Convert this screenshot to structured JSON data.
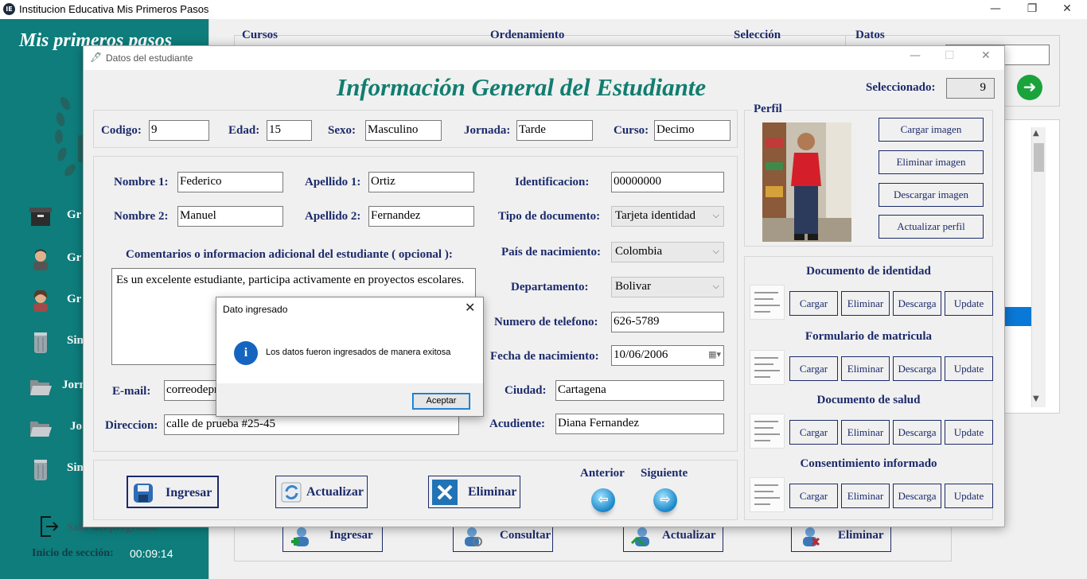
{
  "window": {
    "title": "Institucion Educativa Mis Primeros Pasos",
    "app_icon": "IE",
    "minimize": "—",
    "restore": "❐",
    "close": "✕"
  },
  "sidebar": {
    "brand": "Mis primeros pasos",
    "items": [
      {
        "label": "Gr",
        "icon": "archive-box-icon"
      },
      {
        "label": "Gr",
        "icon": "teacher-icon"
      },
      {
        "label": "Gr",
        "icon": "teacher-woman-icon"
      },
      {
        "label": "Sin",
        "icon": "trash-can-icon"
      },
      {
        "label": "Jorn",
        "icon": "open-folder-icon"
      },
      {
        "label": "Jo",
        "icon": "open-folder-icon"
      },
      {
        "label": "Sin",
        "icon": "trash-can-icon"
      }
    ],
    "logout": "Salir del programa",
    "session_label": "Inicio de sección:",
    "session_time": "00:09:14",
    "color": "#0e7d7c"
  },
  "background": {
    "groups": [
      "Cursos",
      "Ordenamiento",
      "Selección",
      "Datos"
    ],
    "actions": [
      "Ingresar",
      "Consultar",
      "Actualizar",
      "Eliminar"
    ]
  },
  "dialog": {
    "title": "Datos del estudiante",
    "heading": "Información General del Estudiante",
    "selected_label": "Seleccionado:",
    "selected_value": "9",
    "top_row": {
      "codigo_label": "Codigo:",
      "codigo": "9",
      "edad_label": "Edad:",
      "edad": "15",
      "sexo_label": "Sexo:",
      "sexo": "Masculino",
      "jornada_label": "Jornada:",
      "jornada": "Tarde",
      "curso_label": "Curso:",
      "curso": "Decimo"
    },
    "form": {
      "nombre1_label": "Nombre 1:",
      "nombre1": "Federico",
      "apellido1_label": "Apellido 1:",
      "apellido1": "Ortiz",
      "nombre2_label": "Nombre 2:",
      "nombre2": "Manuel",
      "apellido2_label": "Apellido 2:",
      "apellido2": "Fernandez",
      "comments_label": "Comentarios o informacion adicional del estudiante ( opcional ):",
      "comments": "Es un excelente estudiante, participa activamente en proyectos escolares.",
      "email_label": "E-mail:",
      "email": "correodeprueba@gmail.com",
      "direccion_label": "Direccion:",
      "direccion": "calle de prueba #25-45",
      "identificacion_label": "Identificacion:",
      "identificacion": "00000000",
      "tipo_doc_label": "Tipo de documento:",
      "tipo_doc": "Tarjeta identidad",
      "pais_label": "País de nacimiento:",
      "pais": "Colombia",
      "departamento_label": "Departamento:",
      "departamento": "Bolivar",
      "telefono_label": "Numero de telefono:",
      "telefono": "626-5789",
      "fecha_label": "Fecha de nacimiento:",
      "fecha": "10/06/2006",
      "ciudad_label": "Ciudad:",
      "ciudad": "Cartagena",
      "acudiente_label": "Acudiente:",
      "acudiente": "Diana Fernandez"
    },
    "profile": {
      "label": "Perfil",
      "buttons": [
        "Cargar imagen",
        "Eliminar imagen",
        "Descargar imagen",
        "Actualizar perfil"
      ]
    },
    "documents": [
      {
        "title": "Documento de identidad"
      },
      {
        "title": "Formulario de matricula"
      },
      {
        "title": "Documento de salud"
      },
      {
        "title": "Consentimiento informado"
      }
    ],
    "doc_buttons": [
      "Cargar",
      "Eliminar",
      "Descarga",
      "Update"
    ],
    "actions": {
      "ingresar": "Ingresar",
      "actualizar": "Actualizar",
      "eliminar": "Eliminar",
      "anterior": "Anterior",
      "siguiente": "Siguiente"
    }
  },
  "message_box": {
    "title": "Dato ingresado",
    "text": "Los datos fueron ingresados de manera exitosa",
    "icon": "i",
    "ok": "Aceptar"
  }
}
